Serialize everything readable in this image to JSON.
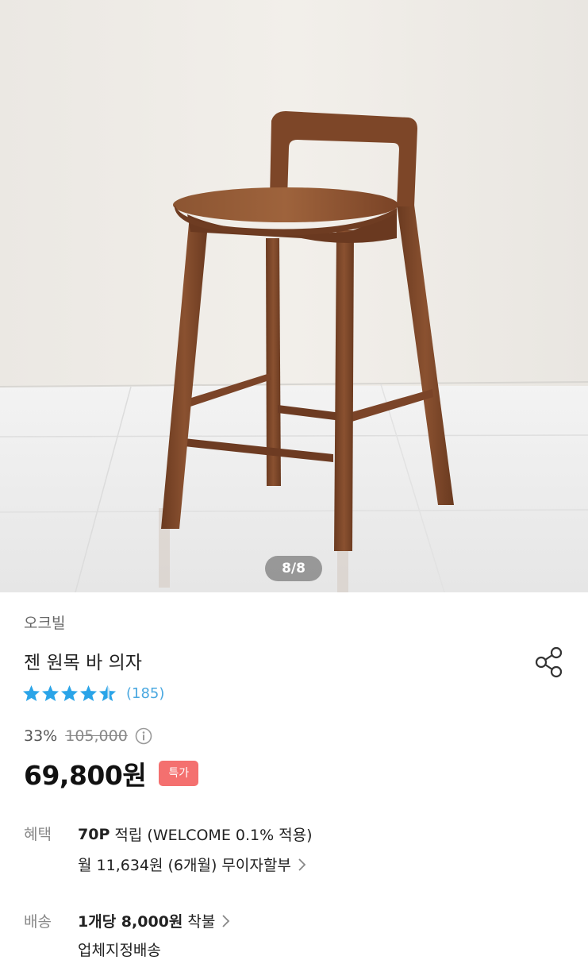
{
  "gallery": {
    "counter": "8/8"
  },
  "product": {
    "brand": "오크빌",
    "name": "젠 원목 바 의자",
    "rating": 4.5,
    "review_count": "(185)",
    "discount": "33%",
    "original_price": "105,000",
    "price": "69,800원",
    "badge": "특가"
  },
  "benefit": {
    "label": "혜택",
    "points_bold": "70P",
    "points_text": " 적립 (WELCOME 0.1% 적용)",
    "installment_text": "월 11,634원 (6개월) 무이자할부"
  },
  "shipping": {
    "label": "배송",
    "per_unit_bold": "1개당 8,000원",
    "per_unit_text": " 착불",
    "partial_text": "업체지정배송"
  },
  "colors": {
    "star": "#2aa4e8",
    "badge": "#f4706f",
    "review": "#4aa8e0",
    "wood": "#7a4326"
  },
  "icons": [
    "share-icon",
    "star-icon",
    "info-icon",
    "chevron-right-icon"
  ]
}
